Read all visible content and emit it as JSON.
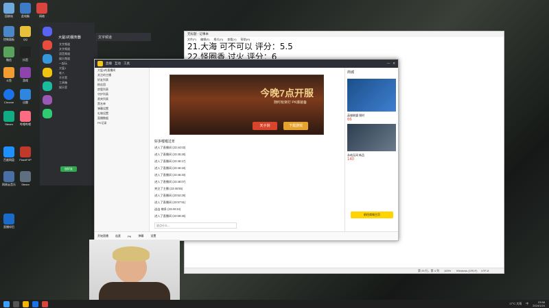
{
  "notepad": {
    "title": "无标题 - 记事本",
    "menu": [
      "文件(F)",
      "编辑(E)",
      "格式(O)",
      "查看(V)",
      "帮助(H)"
    ],
    "lines": [
      "21.大海  可不可以 评分：5.5",
      "22.怪圈香 过火 评分：6"
    ],
    "status": {
      "position": "第 25 行，第 4 列",
      "zoom": "100%",
      "eol": "Windows (CRLF)",
      "encoding": "UTF-8"
    }
  },
  "discord": {
    "header": "大猛1的服务器",
    "channel_title": "文字频道",
    "sidebar": [
      "文字频道",
      "文字频道",
      "语音频道",
      "娱乐频道",
      "一起玩",
      "大猛1",
      "老八",
      "不开黑",
      "工具箱",
      "娱乐室"
    ],
    "footer_button": "加好友"
  },
  "stream": {
    "tabs": [
      "直播",
      "互动",
      "工具"
    ],
    "left_list": [
      "大猛1的直播间",
      "关注的主播",
      "好友列表",
      "粉丝团",
      "房管列表",
      "守护列表",
      "贵宾列表",
      "黑名单",
      "弹幕设置",
      "礼物设置",
      "直播数据",
      "PK记录"
    ],
    "banner": {
      "big": "今晚7点开服",
      "sub": "随时有架打 PK爆装备",
      "btn1": "天子剑",
      "btn2": "下载游戏"
    },
    "notice": "好多喔喔过年",
    "logs": [
      "进入了直播间 (23:44:03)",
      "进入了直播间 (23:45:28)",
      "进入了直播间 (23:46:17)",
      "进入了直播间 (23:46:18)",
      "进入了直播间 (23:46:33)",
      "进入了直播间 (23:48:07)",
      "关注了主播 (23:48:55)",
      "进入了直播间 (23:52:29)",
      "进入了直播间 (23:57:51)",
      "送出 辣条 (23:48:34)",
      "进入了直播间 (23:58:26)"
    ],
    "chat_placeholder": "说点什么...",
    "footer": [
      "开始直播",
      "连麦",
      "PK",
      "弹幕",
      "设置"
    ],
    "right": {
      "title": "商城",
      "items": [
        {
          "label": "英雄联盟 限时",
          "price": "66"
        },
        {
          "label": "永劫无间 新品",
          "price": "140"
        }
      ],
      "cta": "前往商城主页"
    }
  },
  "desktop_icons": [
    "回收站",
    "此电脑",
    "网络",
    "控制面板",
    "QQ",
    "微信",
    "抖音",
    "斗鱼",
    "游戏",
    "Chrome",
    "迅雷",
    "Steam",
    "哔哩哔哩",
    "百度网盘",
    "FlashFXP",
    "网易云音乐",
    "Steam",
    "直播伴侣"
  ],
  "taskbar": {
    "time": "23:58",
    "date": "2024/1/24",
    "weather": "17°C 大雨",
    "lang": "中"
  }
}
